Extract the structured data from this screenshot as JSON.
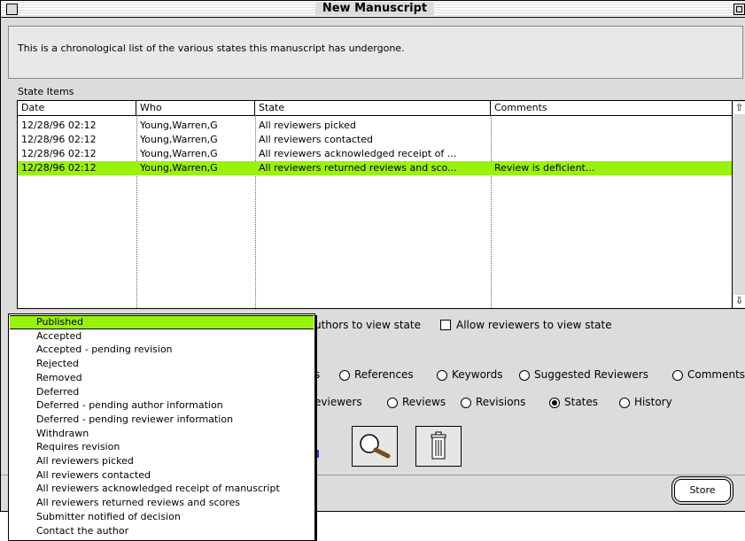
{
  "window": {
    "title": "New Manuscript"
  },
  "description": "This is a chronological list of the various states this manuscript has undergone.",
  "state_items": {
    "label": "State Items",
    "columns": [
      "Date",
      "Who",
      "State",
      "Comments"
    ],
    "rows": [
      {
        "date": "12/28/96 02:12",
        "who": "Young,Warren,G",
        "state": "All reviewers picked",
        "comments": ""
      },
      {
        "date": "12/28/96 02:12",
        "who": "Young,Warren,G",
        "state": "All reviewers contacted",
        "comments": ""
      },
      {
        "date": "12/28/96 02:12",
        "who": "Young,Warren,G",
        "state": "All reviewers acknowledged receipt of ...",
        "comments": ""
      },
      {
        "date": "12/28/96 02:12",
        "who": "Young,Warren,G",
        "state": "All reviewers returned reviews and sco...",
        "comments": "Review is deficient..."
      }
    ],
    "selected_row": 3
  },
  "checkboxes": {
    "authors_view": {
      "label": "uthors to view state",
      "checked": false
    },
    "reviewers_view": {
      "label": "Allow reviewers to view state",
      "checked": false
    }
  },
  "tabs_row1": [
    {
      "label": "s",
      "partial": true
    },
    {
      "label": "References",
      "selected": false
    },
    {
      "label": "Keywords",
      "selected": false
    },
    {
      "label": "Suggested Reviewers",
      "selected": false
    },
    {
      "label": "Comments",
      "selected": false
    }
  ],
  "tabs_row2": [
    {
      "label": "eviewers",
      "partial": true
    },
    {
      "label": "Reviews",
      "selected": false
    },
    {
      "label": "Revisions",
      "selected": false
    },
    {
      "label": "States",
      "selected": true
    },
    {
      "label": "History",
      "selected": false
    }
  ],
  "toolbar": {
    "icons": [
      "edit-icon",
      "magnify-icon",
      "trash-icon"
    ]
  },
  "store_label": "Store",
  "popup_menu": {
    "items": [
      "Published",
      "Accepted",
      "Accepted - pending revision",
      "Rejected",
      "Removed",
      "Deferred",
      "Deferred - pending author information",
      "Deferred - pending reviewer information",
      "Withdrawn",
      "Requires revision",
      "All reviewers picked",
      "All reviewers contacted",
      "All reviewers acknowledged receipt of manuscript",
      "All reviewers returned reviews and scores",
      "Submitter notified of decision",
      "Contact the author"
    ],
    "selected_index": 0
  },
  "colors": {
    "highlight": "#99f20c",
    "window_bg": "#dcdcdc"
  }
}
